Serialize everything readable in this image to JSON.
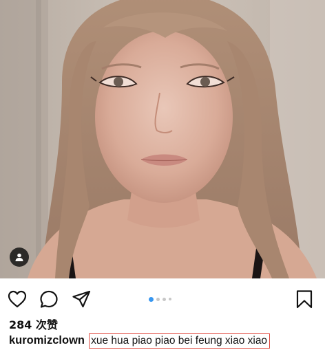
{
  "post": {
    "photo": {
      "description_icon": "user-tag-icon"
    },
    "actions": {
      "like_icon": "heart-icon",
      "comment_icon": "comment-bubble-icon",
      "share_icon": "paper-plane-icon",
      "save_icon": "bookmark-icon"
    },
    "carousel": {
      "total_dots": 4,
      "active_index": 0,
      "active_color": "#3897f0",
      "inactive_color": "#c7c7c7"
    },
    "likes_label": "284 次赞",
    "caption": {
      "username": "kuromizclown",
      "text": "xue hua piao piao bei feung xiao xiao",
      "highlight_color": "#e0483e"
    }
  }
}
